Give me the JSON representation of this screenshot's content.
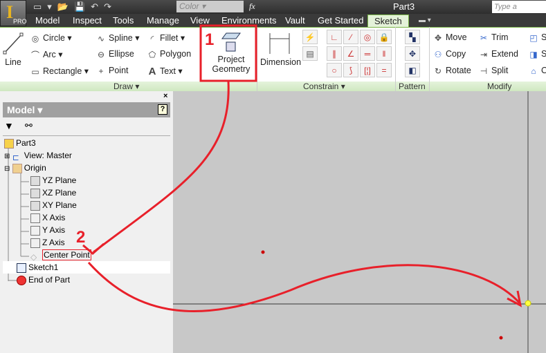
{
  "app": {
    "logo_text": "I",
    "edition": "PRO",
    "title": "Part3",
    "search_placeholder": "Type a keyword",
    "color_select": "Color",
    "fx": "fx"
  },
  "tabs": [
    {
      "label": "Model"
    },
    {
      "label": "Inspect"
    },
    {
      "label": "Tools"
    },
    {
      "label": "Manage"
    },
    {
      "label": "View"
    },
    {
      "label": "Environments"
    },
    {
      "label": "Vault"
    },
    {
      "label": "Get Started"
    },
    {
      "label": "Sketch",
      "active": true
    }
  ],
  "draw": {
    "line": "Line",
    "circle": "Circle",
    "arc": "Arc",
    "rectangle": "Rectangle",
    "spline": "Spline",
    "ellipse": "Ellipse",
    "point": "Point",
    "fillet": "Fillet",
    "polygon": "Polygon",
    "text": "Text",
    "project_geometry_1": "Project",
    "project_geometry_2": "Geometry",
    "panel": "Draw"
  },
  "constrain": {
    "dimension": "Dimension",
    "panel": "Constrain"
  },
  "pattern": {
    "panel": "Pattern"
  },
  "modify": {
    "move": "Move",
    "copy": "Copy",
    "rotate": "Rotate",
    "trim": "Trim",
    "extend": "Extend",
    "split": "Split",
    "scale": "Sc",
    "stretch": "St",
    "offset": "O",
    "panel": "Modify"
  },
  "browser": {
    "title": "Model",
    "tree": [
      {
        "label": "Part3"
      },
      {
        "label": "View: Master"
      },
      {
        "label": "Origin"
      },
      {
        "label": "YZ Plane"
      },
      {
        "label": "XZ Plane"
      },
      {
        "label": "XY Plane"
      },
      {
        "label": "X Axis"
      },
      {
        "label": "Y Axis"
      },
      {
        "label": "Z Axis"
      },
      {
        "label": "Center Point"
      },
      {
        "label": "Sketch1"
      },
      {
        "label": "End of Part"
      }
    ]
  },
  "annotations": {
    "step1": "1",
    "step2": "2",
    "color": "#e8202a"
  }
}
